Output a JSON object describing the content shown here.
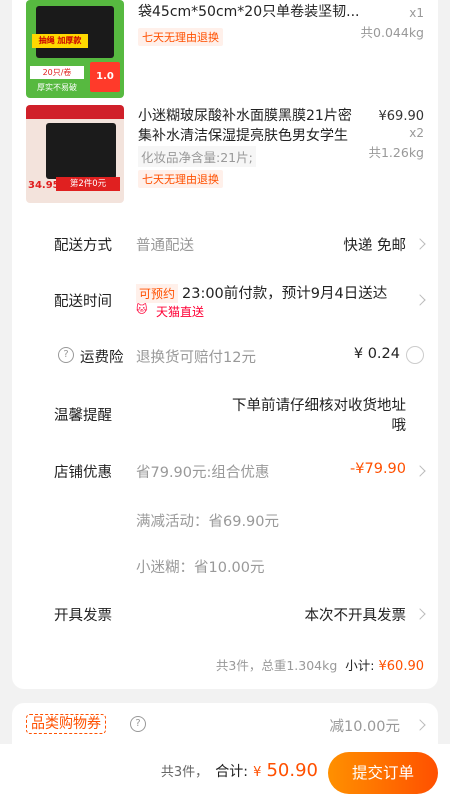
{
  "products": [
    {
      "title": "袋45cm*50cm*20只单卷装坚韧...",
      "qty": "x1",
      "weight": "共0.044kg",
      "return_tag": "七天无理由退换",
      "thumb_texts": [
        "抽绳 加厚款",
        "20只/卷",
        "1.0",
        "厚实不易破"
      ]
    },
    {
      "title": "小迷糊玻尿酸补水面膜黑膜21片密集补水清洁保湿提亮肤色男女学生",
      "price": "¥69.90",
      "qty": "x2",
      "weight": "共1.26kg",
      "spec": "化妆品净含量:21片;",
      "return_tag": "七天无理由退换",
      "thumb_texts": [
        "第2件0元",
        "34.95"
      ]
    }
  ],
  "delivery": {
    "label": "配送方式",
    "value_left": "普通配送",
    "value_right": "快递 免邮"
  },
  "delivery_time": {
    "label": "配送时间",
    "badge": "可预约",
    "text": "23:00前付款，预计9月4日送达",
    "service": "天猫直送"
  },
  "freight_insurance": {
    "label": "运费险",
    "desc": "退换货可赔付12元",
    "price": "¥ 0.24"
  },
  "reminder": {
    "label": "温馨提醒",
    "text": "下单前请仔细核对收货地址哦"
  },
  "shop_discount": {
    "label": "店铺优惠",
    "desc": "省79.90元:组合优惠",
    "amount": "-¥79.90",
    "sub1": "满减活动：省69.90元",
    "sub2": "小迷糊：省10.00元"
  },
  "invoice": {
    "label": "开具发票",
    "value": "本次不开具发票"
  },
  "summary": {
    "text": "共3件，总重1.304kg",
    "subtotal_label": "小计:",
    "subtotal": "¥60.90"
  },
  "coupon": {
    "label": "品类购物券",
    "value": "减10.00元"
  },
  "footer": {
    "count": "共3件，",
    "total_label": "合计:",
    "currency": "¥",
    "total": "50.90",
    "submit": "提交订单"
  },
  "colors": {
    "accent": "#ff5000",
    "accent_gradient_start": "#ff9000",
    "tmall_red": "#ff0036"
  }
}
